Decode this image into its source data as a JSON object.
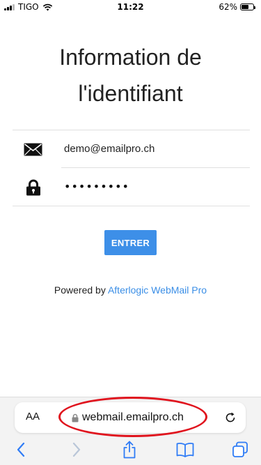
{
  "status_bar": {
    "carrier": "TIGO",
    "time": "11:22",
    "battery": "62%",
    "battery_level": 0.62
  },
  "page": {
    "title_line1": "Information de",
    "title_line2": "l'identifiant"
  },
  "login_form": {
    "email_value": "demo@emailpro.ch",
    "password_dots": "•••••••••",
    "submit_label": "ENTRER"
  },
  "footer": {
    "powered_prefix": "Powered by ",
    "powered_link": "Afterlogic WebMail Pro"
  },
  "browser": {
    "text_size_label": "AA",
    "url": "webmail.emailpro.ch"
  },
  "colors": {
    "accent": "#3d8fe8",
    "link": "#3a8ee6",
    "annotation": "#e0141e",
    "toolbar_icon": "#2f7cf6"
  },
  "icons": {
    "email": "envelope-icon",
    "password": "padlock-icon",
    "secure": "lock-icon",
    "reload": "reload-icon",
    "back": "chevron-left-icon",
    "forward": "chevron-right-icon",
    "share": "share-icon",
    "bookmarks": "book-icon",
    "tabs": "tabs-icon"
  }
}
